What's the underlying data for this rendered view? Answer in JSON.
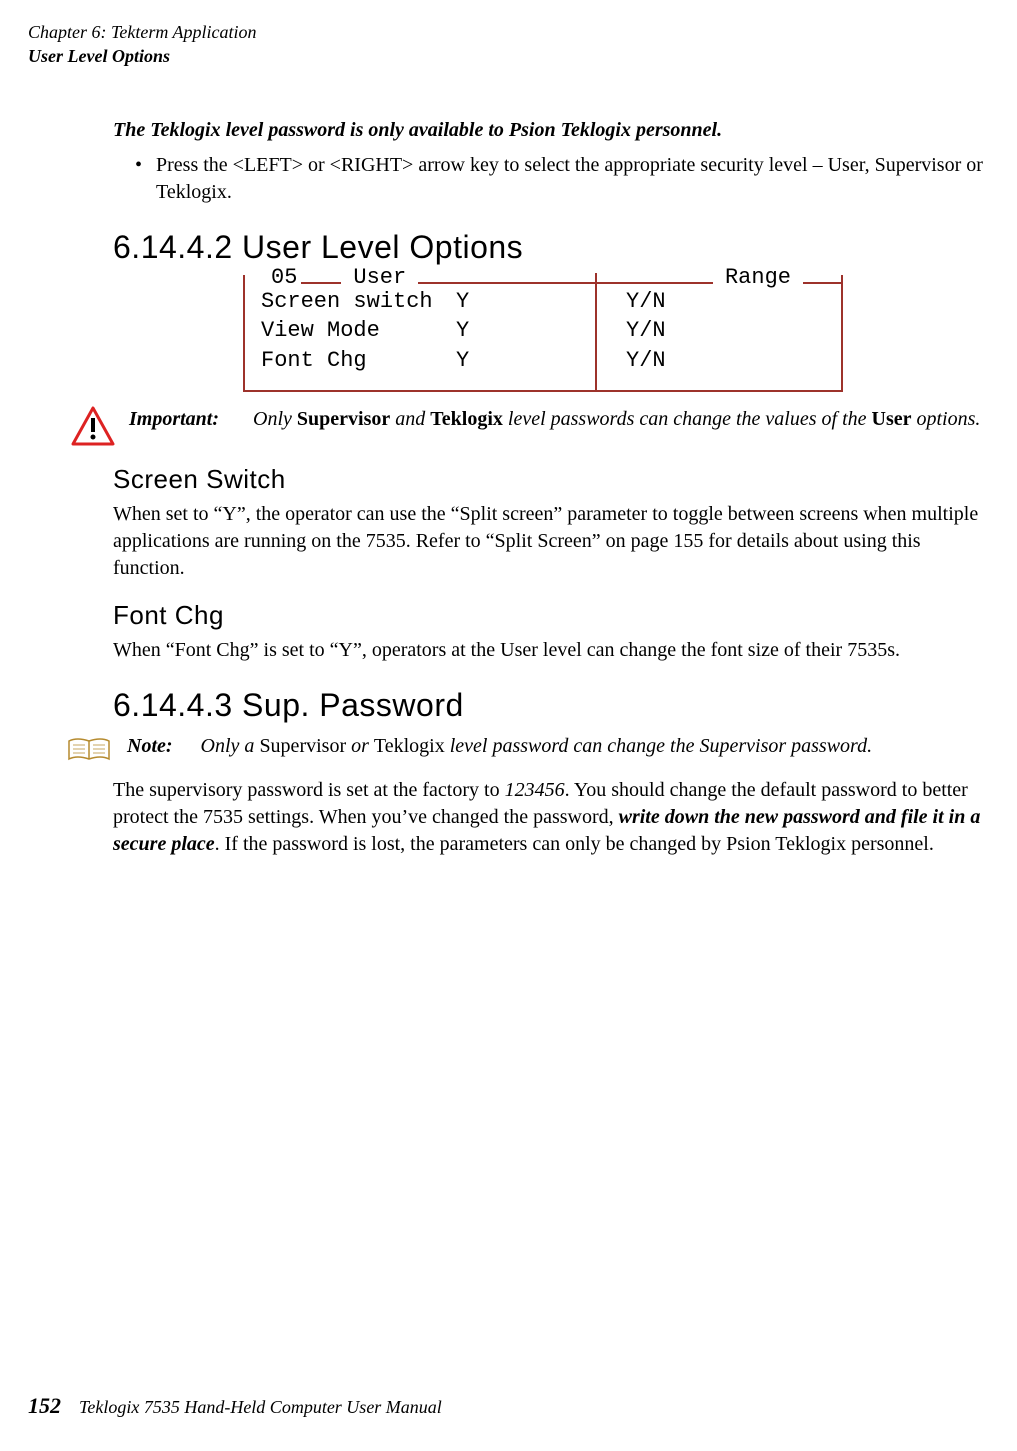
{
  "header": {
    "chapter": "Chapter 6: Tekterm Application",
    "section": "User Level Options"
  },
  "intro": {
    "lead": "The Teklogix level password is only available to Psion Teklogix personnel.",
    "bullet": "Press the <LEFT> or <RIGHT> arrow key to select the appropriate security level – User, Supervisor or Teklogix."
  },
  "s6_14_4_2": {
    "title": "6.14.4.2  User Level Options",
    "diagram": {
      "num": "05",
      "label_user": "User",
      "label_range": "Range",
      "rows": [
        {
          "name": "Screen switch",
          "val": "Y",
          "range": "Y/N"
        },
        {
          "name": "View Mode",
          "val": "Y",
          "range": "Y/N"
        },
        {
          "name": "Font Chg",
          "val": "Y",
          "range": "Y/N"
        }
      ]
    },
    "important": {
      "label": "Important:",
      "pre": "Only ",
      "sup": "Supervisor",
      "mid": " and ",
      "tek": "Teklogix",
      "post": " level passwords can change the values of the ",
      "user": "User",
      "final": " options."
    },
    "screenswitch": {
      "heading": "Screen Switch",
      "text": "When set to “Y”, the operator can use the “Split screen” parameter to toggle between screens when multiple applications are running on the 7535. Refer to “Split Screen” on page 155 for details about using this function."
    },
    "fontchg": {
      "heading": "Font Chg",
      "text": "When “Font Chg” is set to “Y”, operators at the User level can change the font size of their 7535s."
    }
  },
  "s6_14_4_3": {
    "title": "6.14.4.3  Sup. Password",
    "note": {
      "label": "Note:",
      "pre": "Only a ",
      "sup": "Supervisor",
      "mid": " or ",
      "tek": "Teklogix",
      "post": " level password can change the Supervisor password."
    },
    "body": {
      "pre": "The supervisory password is set at the factory to ",
      "pw": "123456",
      "post1": ". You should change the default password to better protect the 7535 settings. When you’ve changed the password, ",
      "emph": "write down the new password and file it in a secure place",
      "post2": ". If the password is lost, the parameters can only be changed by Psion Teklogix personnel."
    }
  },
  "footer": {
    "page": "152",
    "text": "Teklogix 7535 Hand-Held Computer User Manual"
  }
}
